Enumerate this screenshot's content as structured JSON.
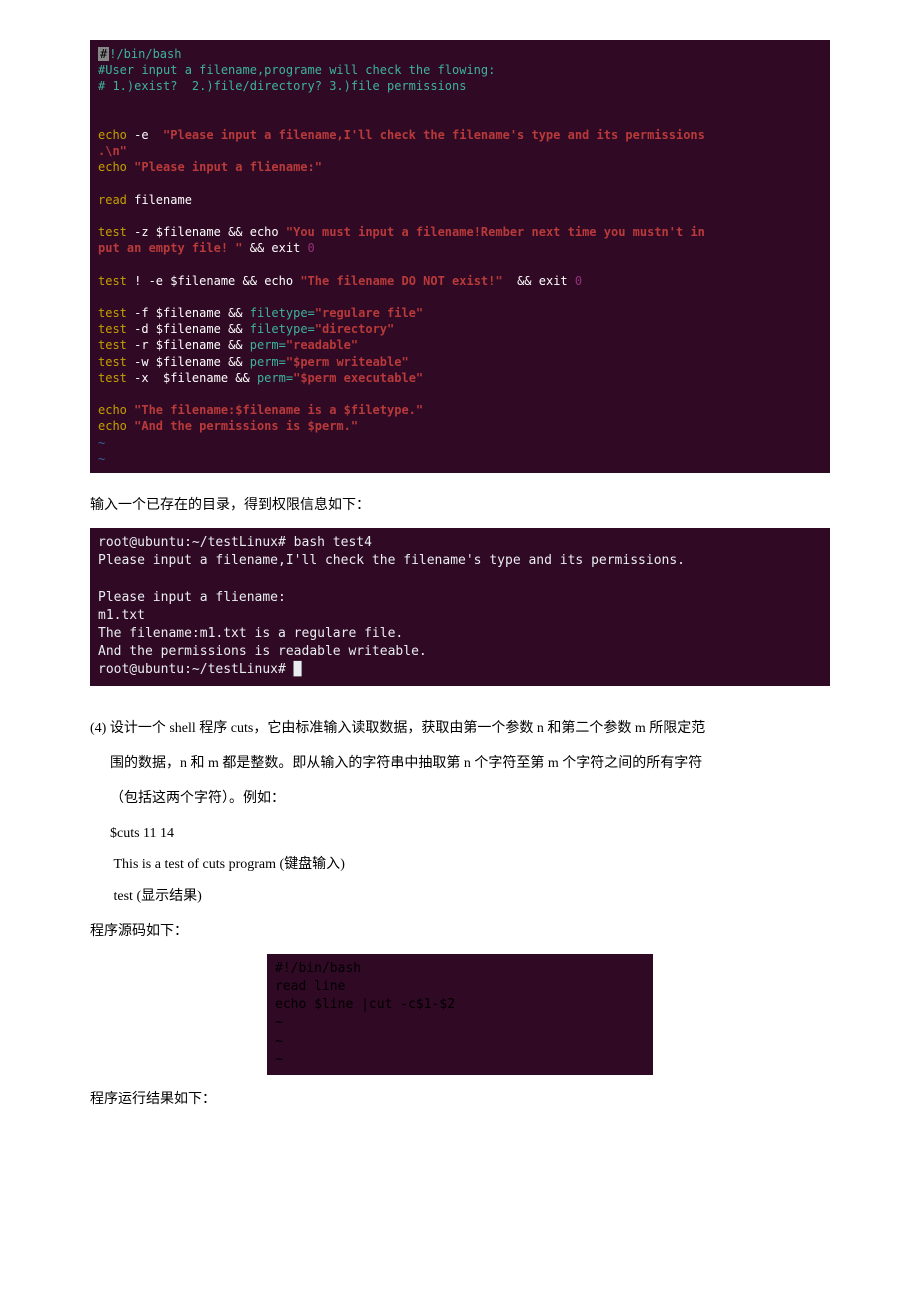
{
  "code1": {
    "l1a": "#",
    "l1b": "!/bin/bash",
    "l2": "#User input a filename,programe will check the flowing:",
    "l3": "# 1.)exist?  2.)file/directory? 3.)file permissions",
    "l4a": "echo",
    "l4b": " -e  ",
    "l4c": "\"Please input a filename,I'll check the filename's type and its permissions",
    "l5a": ".\\n\"",
    "l6a": "echo",
    "l6b": " \"Please input a fliename:\"",
    "l8a": "read",
    "l8b": " filename",
    "l10a": "test",
    "l10b": " -z $filename ",
    "l10c": "&& echo",
    "l10d": " \"You must input a filename!Rember next time you mustn't in",
    "l11a": "put an empty file! \"",
    "l11b": " && exit",
    "l11c": " 0",
    "l13a": "test",
    "l13b": " !",
    "l13c": " -e $filename ",
    "l13d": "&& echo",
    "l13e": " \"The filename DO NOT exist!\" ",
    "l13f": " && exit",
    "l13g": " 0",
    "l15a": "test",
    "l15b": " -f $filename ",
    "l15c": "&&",
    "l15d": " filetype=",
    "l15e": "\"regulare file\"",
    "l16a": "test",
    "l16b": " -d $filename ",
    "l16c": "&&",
    "l16d": " filetype=",
    "l16e": "\"directory\"",
    "l17a": "test",
    "l17b": " -r $filename ",
    "l17c": "&&",
    "l17d": " perm=",
    "l17e": "\"readable\"",
    "l18a": "test",
    "l18b": " -w $filename ",
    "l18c": "&&",
    "l18d": " perm=",
    "l18e": "\"$perm writeable\"",
    "l19a": "test",
    "l19b": " -x  $filename ",
    "l19c": "&&",
    "l19d": " perm=",
    "l19e": "\"$perm executable\"",
    "l21a": "echo",
    "l21b": " \"The filename:$filename is a $filetype.\"",
    "l22a": "echo",
    "l22b": " \"And the permissions is $perm.\"",
    "tilde": "~"
  },
  "text1": "输入一个已存在的目录，得到权限信息如下：",
  "term1": {
    "l1": "root@ubuntu:~/testLinux# bash test4",
    "l2": "Please input a filename,I'll check the filename's type and its permissions.",
    "l3": "",
    "l4": "Please input a fliename:",
    "l5": "m1.txt",
    "l6": "The filename:m1.txt is a regulare file.",
    "l7": "And the permissions is readable writeable.",
    "l8": "root@ubuntu:~/testLinux# "
  },
  "sec4": {
    "title": "(4)  设计一个 shell 程序 cuts，它由标准输入读取数据，获取由第一个参数 n 和第二个参数 m 所限定范",
    "p2": "围的数据，n 和 m 都是整数。即从输入的字符串中抽取第 n 个字符至第 m 个字符之间的所有字符",
    "p3": "（包括这两个字符）。例如：",
    "ex1": "$cuts 11 14",
    "ex2a": "This is a test of cuts program (",
    "ex2b": "键盘输入",
    "ex2c": ")",
    "ex3a": "test (",
    "ex3b": "显示结果",
    "ex3c": ")",
    "src": "程序源码如下："
  },
  "code3": {
    "l1a": "#",
    "l1b": "!/bin/bash",
    "l2a": "read",
    "l2b": " line",
    "l3a": "echo",
    "l3b": " $line ",
    "l3c": "|cut",
    "l3d": " -c$1-$2",
    "tilde": "~"
  },
  "text2": "程序运行结果如下："
}
